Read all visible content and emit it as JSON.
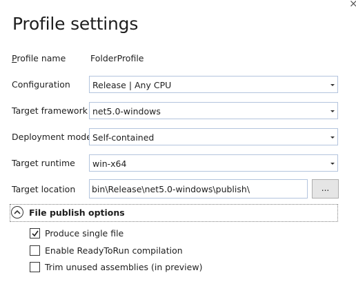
{
  "window": {
    "close_glyph": "×"
  },
  "page_title": "Profile settings",
  "profile_name": {
    "label_first": "P",
    "label_rest": "rofile name",
    "value": "FolderProfile"
  },
  "fields": [
    {
      "label": "Configuration",
      "value": "Release | Any CPU"
    },
    {
      "label": "Target framework",
      "value": "net5.0-windows"
    },
    {
      "label": "Deployment mode",
      "value": "Self-contained"
    },
    {
      "label": "Target runtime",
      "value": "win-x64"
    }
  ],
  "target_location": {
    "label": "Target location",
    "value": "bin\\Release\\net5.0-windows\\publish\\",
    "browse_label": "..."
  },
  "publish_options": {
    "title": "File publish options",
    "expanded": true,
    "options": [
      {
        "label": "Produce single file",
        "checked": true
      },
      {
        "label": "Enable ReadyToRun compilation",
        "checked": false
      },
      {
        "label": "Trim unused assemblies (in preview)",
        "checked": false
      }
    ]
  },
  "icons": {
    "close": "close-icon",
    "dropdown": "chevron-down-icon",
    "collapse": "chevron-up-icon",
    "check": "checkmark-icon"
  }
}
